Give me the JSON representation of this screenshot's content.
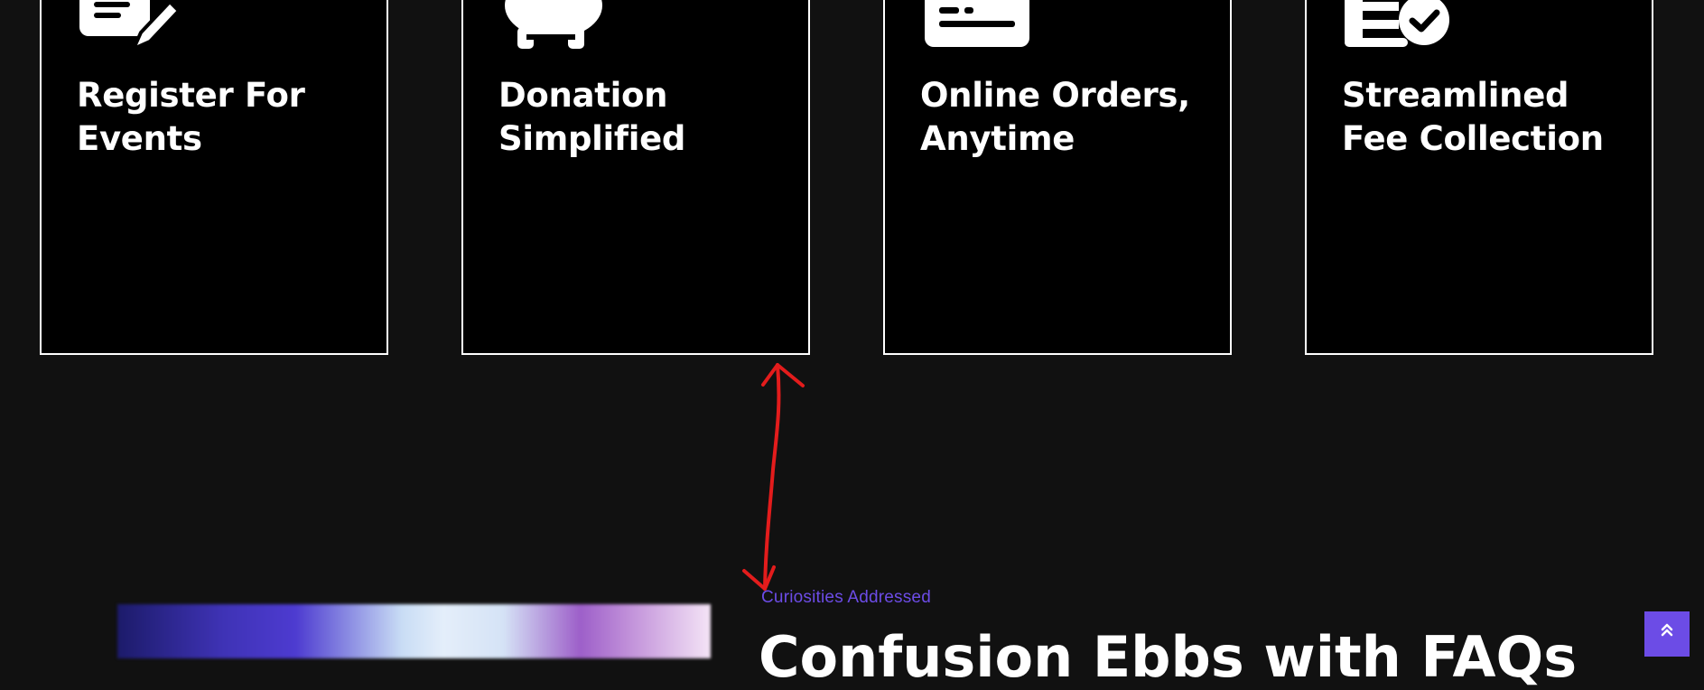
{
  "features": [
    {
      "title_line1": "Register For",
      "title_line2": "Events",
      "icon": "edit-document-icon"
    },
    {
      "title_line1": "Donation",
      "title_line2": "Simplified",
      "icon": "piggy-bank-icon"
    },
    {
      "title_line1": "Online Orders,",
      "title_line2": "Anytime",
      "icon": "credit-card-icon"
    },
    {
      "title_line1": "Streamlined",
      "title_line2": "Fee Collection",
      "icon": "list-check-icon"
    }
  ],
  "faq": {
    "eyebrow": "Curiosities Addressed",
    "heading": "Confusion Ebbs with FAQs"
  },
  "annotation": {
    "type": "double-headed-arrow",
    "color": "#e31c1c"
  },
  "colors": {
    "background": "#111111",
    "card_bg": "#000000",
    "card_border": "#ffffff",
    "accent": "#6c4ce6"
  },
  "back_to_top": {
    "icon": "double-chevron-up-icon"
  }
}
